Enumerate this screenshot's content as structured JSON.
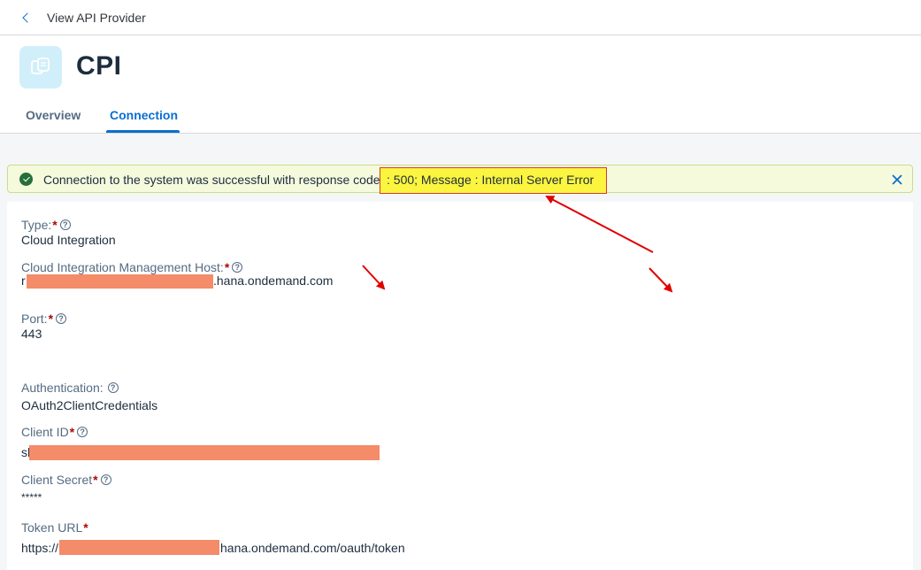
{
  "topbar": {
    "title": "View API Provider"
  },
  "header": {
    "title": "CPI",
    "tabs": [
      {
        "label": "Overview"
      },
      {
        "label": "Connection"
      }
    ]
  },
  "message_strip": {
    "text_before": "Connection to the system was successful with response code",
    "text_highlighted": ": 500; Message : Internal Server Error"
  },
  "form": {
    "type": {
      "label": "Type:",
      "value": "Cloud Integration"
    },
    "host": {
      "label": "Cloud Integration Management Host:",
      "value_prefix": "r",
      "value_suffix": ".hana.ondemand.com"
    },
    "port": {
      "label": "Port:",
      "value": "443"
    },
    "authentication": {
      "label": "Authentication:",
      "value": "OAuth2ClientCredentials"
    },
    "client_id": {
      "label": "Client ID",
      "value_prefix": "sl"
    },
    "client_secret": {
      "label": "Client Secret",
      "value": "*****"
    },
    "token_url": {
      "label": "Token URL",
      "value_prefix": "https://",
      "value_suffix": "hana.ondemand.com/oauth/token"
    }
  },
  "required_marker": "*",
  "help_glyph": "?",
  "colors": {
    "accent": "#0a6ed1",
    "success": "#256f3a",
    "highlight": "#fcf53f",
    "redaction": "#f48b69",
    "annotation_arrow": "#e00000"
  },
  "icons": [
    "chevron-left-icon",
    "app-copy-icon",
    "success-check-icon",
    "close-icon",
    "help-icon"
  ]
}
